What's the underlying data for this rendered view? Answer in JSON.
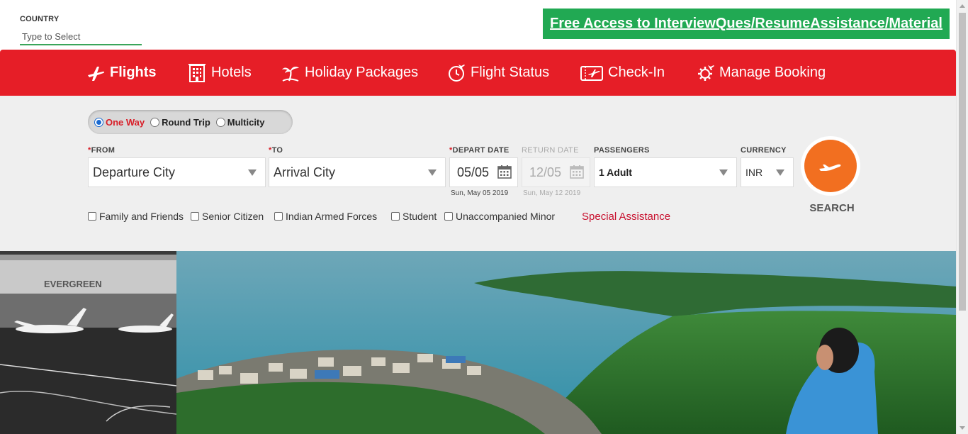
{
  "top": {
    "country_label": "COUNTRY",
    "country_placeholder": "Type to Select",
    "promo_text": "Free Access to InterviewQues/ResumeAssistance/Material"
  },
  "nav": {
    "items": [
      {
        "label": "Flights",
        "icon": "airplane-icon",
        "active": true
      },
      {
        "label": "Hotels",
        "icon": "hotel-building-icon",
        "active": false
      },
      {
        "label": "Holiday Packages",
        "icon": "palm-tree-icon",
        "active": false
      },
      {
        "label": "Flight Status",
        "icon": "flight-clock-icon",
        "active": false
      },
      {
        "label": "Check-In",
        "icon": "boarding-pass-icon",
        "active": false
      },
      {
        "label": "Manage Booking",
        "icon": "gear-plane-icon",
        "active": false
      }
    ]
  },
  "search": {
    "trip_types": [
      {
        "label": "One Way",
        "selected": true
      },
      {
        "label": "Round Trip",
        "selected": false
      },
      {
        "label": "Multicity",
        "selected": false
      }
    ],
    "from_label": "FROM",
    "from_value": "Departure City",
    "to_label": "TO",
    "to_value": "Arrival City",
    "depart_label": "DEPART DATE",
    "depart_value": "05/05",
    "depart_sub": "Sun, May 05 2019",
    "return_label": "RETURN DATE",
    "return_value": "12/05",
    "return_sub": "Sun, May 12 2019",
    "passengers_label": "PASSENGERS",
    "passengers_value": "1 Adult",
    "currency_label": "CURRENCY",
    "currency_value": "INR",
    "search_label": "SEARCH",
    "required_marker": "*",
    "fare_options": [
      {
        "label": "Family and Friends"
      },
      {
        "label": "Senior Citizen"
      },
      {
        "label": "Indian Armed Forces"
      },
      {
        "label": "Student"
      },
      {
        "label": "Unaccompanied Minor"
      }
    ],
    "special_assistance": "Special Assistance"
  },
  "hero": {
    "hangar_sign": "EVERGREEN"
  },
  "colors": {
    "brand_red": "#e61e27",
    "search_orange": "#f26f20",
    "promo_green": "#21a953",
    "country_underline": "#3aa55a"
  }
}
